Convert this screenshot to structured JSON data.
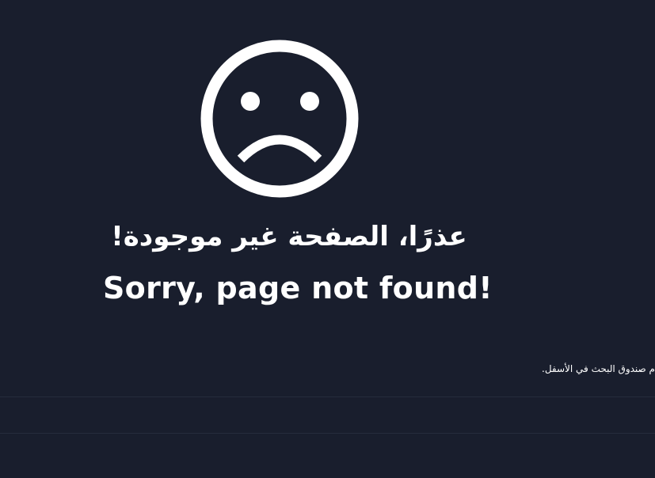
{
  "error": {
    "icon": "sad-face-icon",
    "title_ar": "عذرًا، الصفحة غير موجودة!",
    "title_en": "Sorry, page not found!",
    "hint_ar": "م صندوق البحث في الأسفل."
  },
  "colors": {
    "background": "#191e2d",
    "foreground": "#ffffff",
    "divider": "#262c3c"
  }
}
